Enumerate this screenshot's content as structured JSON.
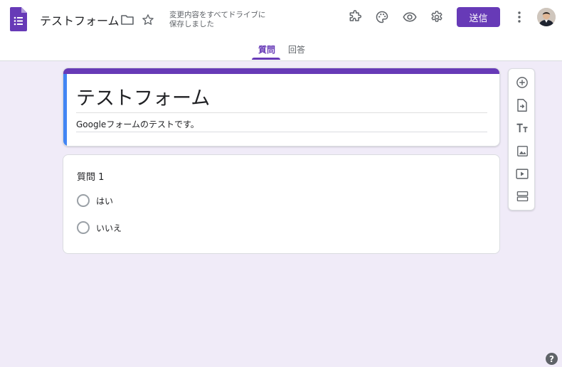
{
  "header": {
    "title": "テストフォーム",
    "save_status_line1": "変更内容をすべてドライブに",
    "save_status_line2": "保存しました",
    "send_label": "送信",
    "icons": [
      "forms-logo-icon",
      "folder-icon",
      "star-icon",
      "addon-puzzle-icon",
      "palette-icon",
      "preview-eye-icon",
      "settings-gear-icon",
      "more-vert-icon",
      "avatar"
    ]
  },
  "tabs": [
    {
      "label": "質問",
      "active": true
    },
    {
      "label": "回答",
      "active": false
    }
  ],
  "form": {
    "title": "テストフォーム",
    "description": "Googleフォームのテストです。"
  },
  "question": {
    "title": "質問 1",
    "options": [
      "はい",
      "いいえ"
    ]
  },
  "side_tools": [
    "add-question-icon",
    "import-questions-icon",
    "add-title-icon",
    "add-image-icon",
    "add-video-icon",
    "add-section-icon"
  ],
  "help_label": "?",
  "colors": {
    "accent": "#673ab7",
    "background": "#f0ebf8",
    "header_side": "#4285f4"
  }
}
